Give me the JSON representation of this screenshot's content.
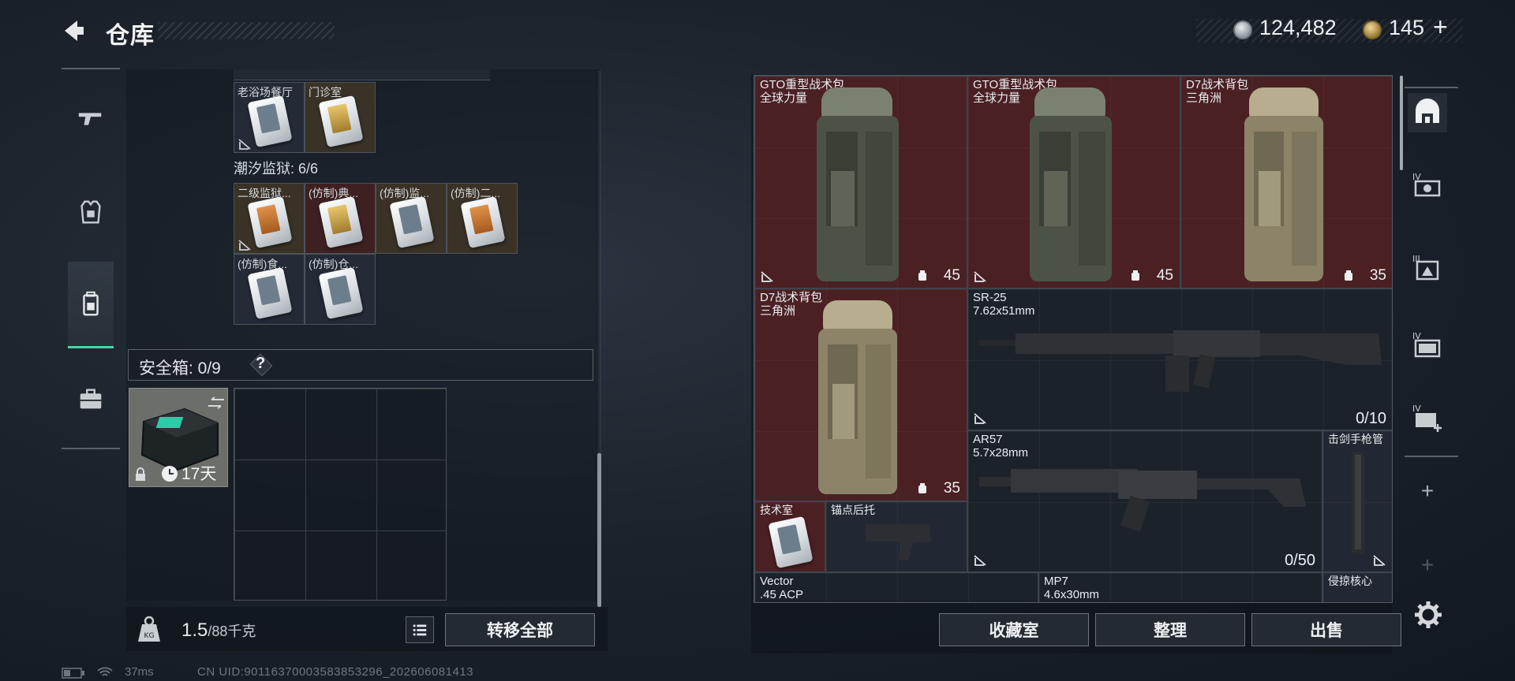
{
  "header": {
    "title": "仓库",
    "silver_amount": "124,482",
    "gold_amount": "145",
    "gold_plus": "+"
  },
  "left_nav": {
    "items": [
      {
        "icon": "gun-icon"
      },
      {
        "icon": "armor-vest-icon"
      },
      {
        "icon": "backpack-icon",
        "active": true
      },
      {
        "icon": "briefcase-icon"
      }
    ]
  },
  "stash": {
    "top_row": [
      {
        "label": "老浴场餐厅",
        "color": "dark"
      },
      {
        "label": "门诊室",
        "color": "brown"
      }
    ],
    "prison_section": "潮汐监狱: 6/6",
    "prison_row1": [
      {
        "label": "二级监狱...",
        "color": "brown",
        "card": "orange"
      },
      {
        "label": "(仿制)典...",
        "color": "red",
        "card": "gold"
      },
      {
        "label": "(仿制)监...",
        "color": "brown",
        "card": "white"
      },
      {
        "label": "(仿制)二...",
        "color": "brown",
        "card": "orange"
      }
    ],
    "prison_row2": [
      {
        "label": "(仿制)食...",
        "color": "dark",
        "card": "white"
      },
      {
        "label": "(仿制)仓...",
        "color": "dark",
        "card": "white"
      }
    ],
    "safe_box_label": "安全箱: 0/9",
    "help_label": "?",
    "safe_item_timer": "17天"
  },
  "weight": {
    "current": "1.5",
    "unit": "/88千克"
  },
  "buttons": {
    "transfer_all": "转移全部",
    "collection_room": "收藏室",
    "organize": "整理",
    "sell": "出售"
  },
  "inventory": {
    "items": [
      {
        "name": "GTO重型战术包",
        "sub": "全球力量",
        "qty": "45"
      },
      {
        "name": "GTO重型战术包",
        "sub": "全球力量",
        "qty": "45"
      },
      {
        "name": "D7战术背包",
        "sub": "三角洲",
        "qty": "35"
      },
      {
        "name": "D7战术背包",
        "sub": "三角洲",
        "qty": "35"
      },
      {
        "name": "SR-25",
        "sub": "7.62x51mm",
        "count": "0/10"
      },
      {
        "name": "AR57",
        "sub": "5.7x28mm",
        "count": "0/50"
      },
      {
        "name": "击剑手枪管",
        "sub": ""
      },
      {
        "name": "技术室",
        "sub": ""
      },
      {
        "name": "锚点后托",
        "sub": ""
      },
      {
        "name": "Vector",
        "sub": ".45 ACP"
      },
      {
        "name": "MP7",
        "sub": "4.6x30mm"
      },
      {
        "name": "侵掠核心",
        "sub": ""
      }
    ]
  },
  "right_sidebar": {
    "items": [
      {
        "icon": "home-base-icon",
        "active": true
      },
      {
        "icon": "tier4-scope-icon",
        "label": "IV"
      },
      {
        "icon": "tier3-armor-icon",
        "label": "III"
      },
      {
        "icon": "tier4-ammo-icon",
        "label": "IV"
      },
      {
        "icon": "tier4-medkit-icon",
        "label": "IV"
      },
      {
        "icon": "add-icon"
      },
      {
        "icon": "add-icon"
      }
    ]
  },
  "status": {
    "ping": "37ms",
    "uid": "CN UID:9011637000358385329​6_202606081413"
  }
}
